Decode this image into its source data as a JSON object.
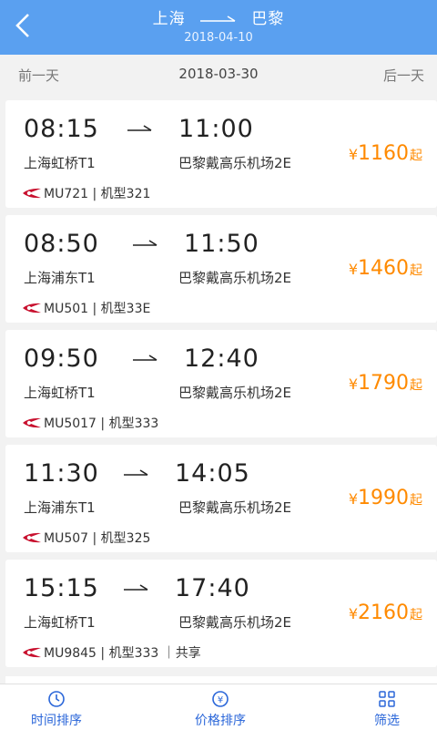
{
  "header": {
    "from": "上海",
    "to": "巴黎",
    "date": "2018-04-10"
  },
  "daybar": {
    "prev": "前一天",
    "current": "2018-03-30",
    "next": "后一天"
  },
  "flights": [
    {
      "dep_time": "08:15",
      "arr_time": "11:00",
      "dep_airport": "上海虹桥T1",
      "arr_airport": "巴黎戴高乐机场2E",
      "price": "1160",
      "info": "MU721 | 机型321"
    },
    {
      "dep_time": "08:50",
      "arr_time": "11:50",
      "dep_airport": "上海浦东T1",
      "arr_airport": "巴黎戴高乐机场2E",
      "price": "1460",
      "info": "MU501 | 机型33E"
    },
    {
      "dep_time": "09:50",
      "arr_time": "12:40",
      "dep_airport": "上海虹桥T1",
      "arr_airport": "巴黎戴高乐机场2E",
      "price": "1790",
      "info": "MU5017 | 机型333"
    },
    {
      "dep_time": "11:30",
      "arr_time": "14:05",
      "dep_airport": "上海浦东T1",
      "arr_airport": "巴黎戴高乐机场2E",
      "price": "1990",
      "info": "MU507 | 机型325"
    },
    {
      "dep_time": "15:15",
      "arr_time": "17:40",
      "dep_airport": "上海虹桥T1",
      "arr_airport": "巴黎戴高乐机场2E",
      "price": "2160",
      "info": "MU9845 | 机型333 ｜共享"
    }
  ],
  "currency": "¥",
  "price_suffix": "起",
  "tabs": {
    "time_sort": "时间排序",
    "price_sort": "价格排序",
    "filter": "筛选"
  },
  "colors": {
    "header": "#5aa0f0",
    "price": "#ff8a00",
    "tab": "#2a66d9",
    "airline_logo": "#c8102e"
  }
}
